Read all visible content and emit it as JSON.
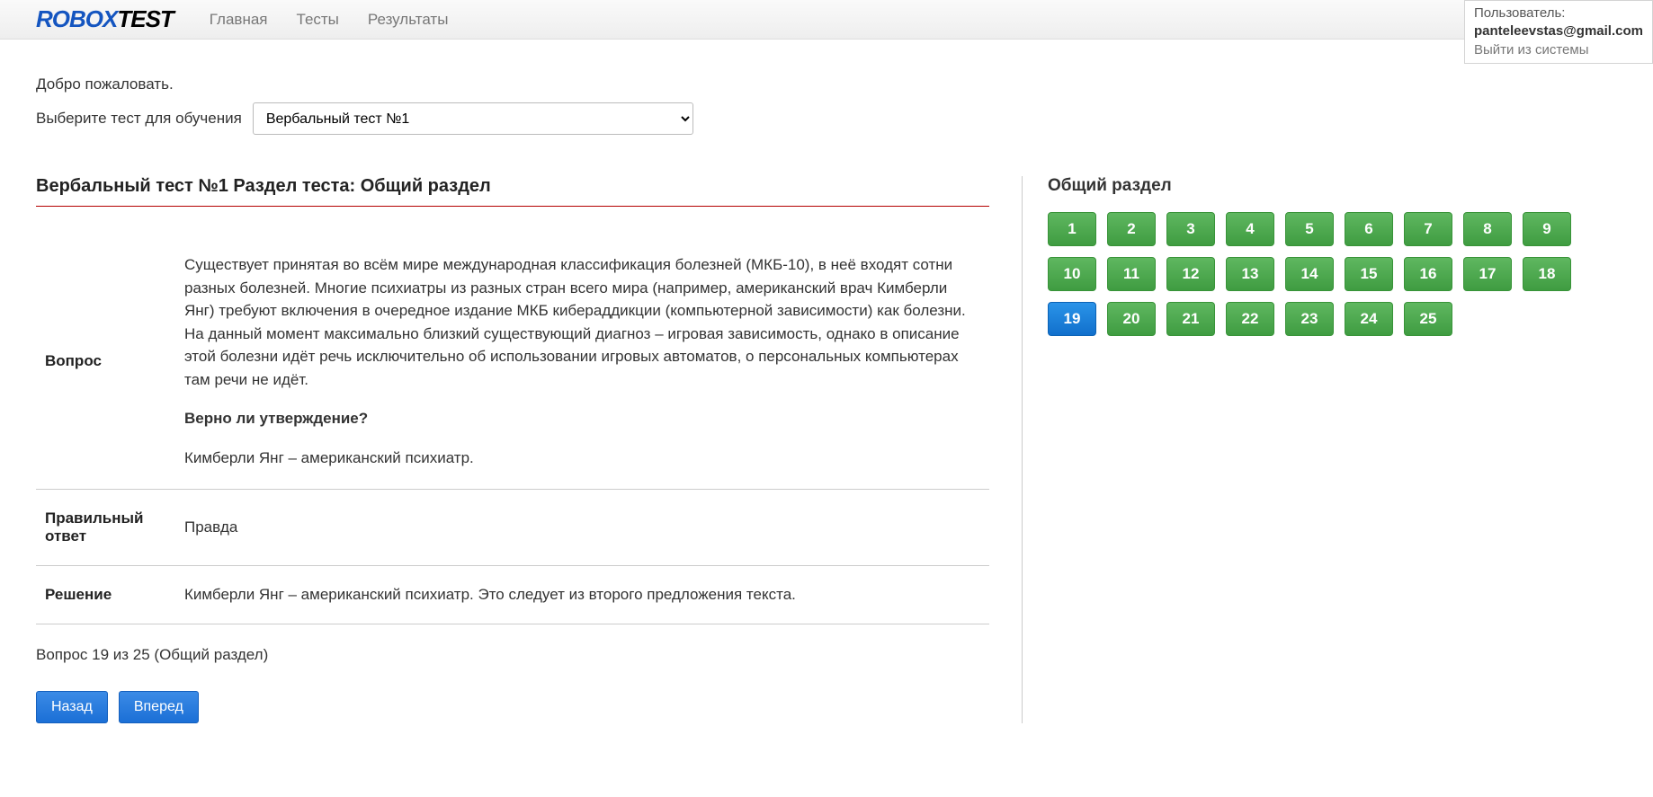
{
  "brand": {
    "p1": "ROBOX",
    "p2": "TEST"
  },
  "nav": {
    "home": "Главная",
    "tests": "Тесты",
    "results": "Результаты"
  },
  "user_box": {
    "label": "Пользователь:",
    "email": "panteleevstas@gmail.com",
    "logout": "Выйти из системы"
  },
  "welcome": "Добро пожаловать.",
  "select_label": "Выберите тест для обучения",
  "select_value": "Вербальный тест №1",
  "test_title": "Вербальный тест №1 Раздел теста: Общий раздел",
  "labels": {
    "question": "Вопрос",
    "answer": "Правильный ответ",
    "solution": "Решение"
  },
  "question": {
    "text": "Существует принятая во всём мире международная классификация болезней (МКБ-10), в неё входят сотни разных болезней. Многие психиатры из разных стран всего мира (например, американский врач Кимберли Янг) требуют включения в очередное издание МКБ кибераддикции (компьютерной зависимости) как болезни. На данный момент максимально близкий существующий диагноз – игровая зависимость, однако в описание этой болезни идёт речь исключительно об использовании игровых автоматов, о персональных компьютерах там речи не идёт.",
    "ask": "Верно ли утверждение?",
    "statement": "Кимберли Янг – американский психиатр."
  },
  "correct_answer": "Правда",
  "solution": "Кимберли Янг – американский психиатр. Это следует из второго предложения текста.",
  "progress": "Вопрос 19 из 25 (Общий раздел)",
  "buttons": {
    "back": "Назад",
    "next": "Вперед"
  },
  "section_title": "Общий раздел",
  "qnums": [
    {
      "n": "1",
      "c": "green"
    },
    {
      "n": "2",
      "c": "green"
    },
    {
      "n": "3",
      "c": "green"
    },
    {
      "n": "4",
      "c": "green"
    },
    {
      "n": "5",
      "c": "green"
    },
    {
      "n": "6",
      "c": "green"
    },
    {
      "n": "7",
      "c": "green"
    },
    {
      "n": "8",
      "c": "green"
    },
    {
      "n": "9",
      "c": "green"
    },
    {
      "n": "10",
      "c": "green"
    },
    {
      "n": "11",
      "c": "green"
    },
    {
      "n": "12",
      "c": "green"
    },
    {
      "n": "13",
      "c": "green"
    },
    {
      "n": "14",
      "c": "green"
    },
    {
      "n": "15",
      "c": "green"
    },
    {
      "n": "16",
      "c": "green"
    },
    {
      "n": "17",
      "c": "green"
    },
    {
      "n": "18",
      "c": "green"
    },
    {
      "n": "19",
      "c": "blue"
    },
    {
      "n": "20",
      "c": "green"
    },
    {
      "n": "21",
      "c": "green"
    },
    {
      "n": "22",
      "c": "green"
    },
    {
      "n": "23",
      "c": "green"
    },
    {
      "n": "24",
      "c": "green"
    },
    {
      "n": "25",
      "c": "green"
    }
  ]
}
